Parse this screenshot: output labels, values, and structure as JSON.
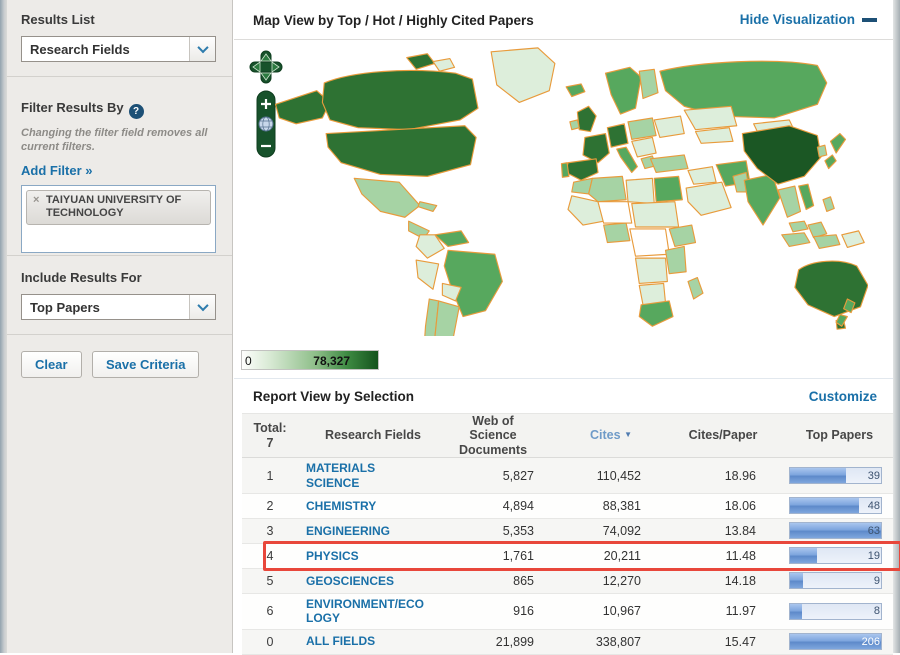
{
  "sidebar": {
    "results_list": {
      "label": "Results List",
      "selected": "Research Fields"
    },
    "filter": {
      "heading": "Filter Results By",
      "help_icon": "?",
      "note": "Changing the filter field removes all current filters.",
      "add_filter_label": "Add Filter »",
      "tags": [
        {
          "label": "TAIYUAN UNIVERSITY OF TECHNOLOGY",
          "remove_icon": "×"
        }
      ]
    },
    "include": {
      "heading": "Include Results For",
      "selected": "Top Papers"
    },
    "buttons": {
      "clear": "Clear",
      "save": "Save Criteria"
    }
  },
  "map": {
    "title": "Map View by Top / Hot / Highly Cited Papers",
    "hide_link": "Hide Visualization",
    "legend": {
      "min": "0",
      "max": "78,327"
    },
    "controls": {
      "zoom_in": "+",
      "zoom_out": "−"
    }
  },
  "report": {
    "title": "Report View by Selection",
    "customize_link": "Customize",
    "header": {
      "total_label": "Total:",
      "total_value": "7",
      "research_fields": "Research Fields",
      "documents": "Web of Science Documents",
      "cites": "Cites",
      "sort_icon": "▼",
      "cites_per_paper": "Cites/Paper",
      "top_papers": "Top Papers"
    },
    "rows": [
      {
        "rank": "1",
        "field": "MATERIALS SCIENCE",
        "documents": "5,827",
        "cites": "110,452",
        "cites_per_paper": "18.96",
        "top_papers": "39",
        "bar_pct": 62
      },
      {
        "rank": "2",
        "field": "CHEMISTRY",
        "documents": "4,894",
        "cites": "88,381",
        "cites_per_paper": "18.06",
        "top_papers": "48",
        "bar_pct": 76
      },
      {
        "rank": "3",
        "field": "ENGINEERING",
        "documents": "5,353",
        "cites": "74,092",
        "cites_per_paper": "13.84",
        "top_papers": "63",
        "bar_pct": 100
      },
      {
        "rank": "4",
        "field": "PHYSICS",
        "documents": "1,761",
        "cites": "20,211",
        "cites_per_paper": "11.48",
        "top_papers": "19",
        "bar_pct": 30,
        "highlighted": true
      },
      {
        "rank": "5",
        "field": "GEOSCIENCES",
        "documents": "865",
        "cites": "12,270",
        "cites_per_paper": "14.18",
        "top_papers": "9",
        "bar_pct": 14
      },
      {
        "rank": "6",
        "field": "ENVIRONMENT/ECOLOGY",
        "documents": "916",
        "cites": "10,967",
        "cites_per_paper": "11.97",
        "top_papers": "8",
        "bar_pct": 13
      },
      {
        "rank": "0",
        "field": "ALL FIELDS",
        "documents": "21,899",
        "cites": "338,807",
        "cites_per_paper": "15.47",
        "top_papers": "206",
        "bar_pct": 100
      }
    ]
  },
  "colors": {
    "link_blue": "#1a70a8",
    "highlight_red": "#e8473b",
    "bar_blue": "#7ea6de",
    "map_green_darkest": "#1b5724",
    "map_green_dark": "#2e7233",
    "map_green_medium": "#57a85e",
    "map_green_light": "#a6d3a4",
    "map_green_pale": "#ddeedb",
    "map_border_orange": "#e89b3c"
  }
}
